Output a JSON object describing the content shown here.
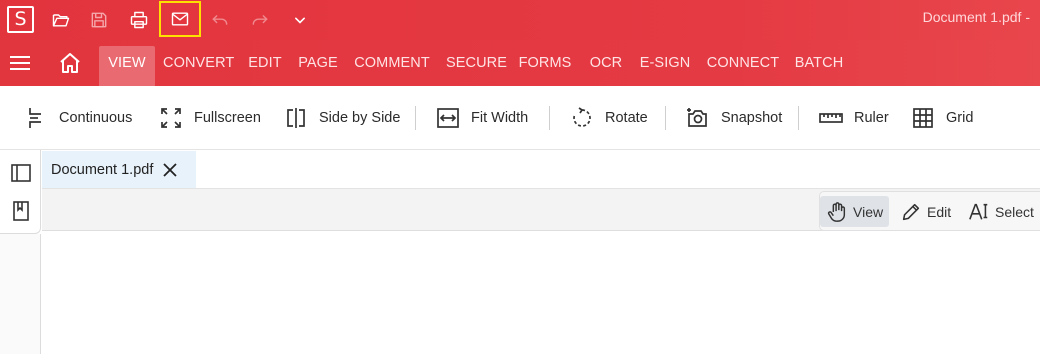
{
  "titlebar": {
    "logo_letter": "S",
    "document_title": "Document 1.pdf  -",
    "quick_access": [
      {
        "icon": "open-folder-icon",
        "highlighted": false
      },
      {
        "icon": "save-icon",
        "highlighted": false
      },
      {
        "icon": "print-icon",
        "highlighted": false
      },
      {
        "icon": "email-icon",
        "highlighted": true
      },
      {
        "icon": "undo-icon",
        "highlighted": false
      },
      {
        "icon": "redo-icon",
        "highlighted": false
      },
      {
        "icon": "chevron-down-icon",
        "highlighted": false
      }
    ]
  },
  "menubar": {
    "items": [
      "VIEW",
      "CONVERT",
      "EDIT",
      "PAGE",
      "COMMENT",
      "SECURE",
      "FORMS",
      "OCR",
      "E-SIGN",
      "CONNECT",
      "BATCH"
    ],
    "active": "VIEW"
  },
  "toolbar": {
    "continuous": "Continuous",
    "fullscreen": "Fullscreen",
    "side_by_side": "Side by Side",
    "fit_width": "Fit Width",
    "rotate": "Rotate",
    "snapshot": "Snapshot",
    "ruler": "Ruler",
    "grid": "Grid"
  },
  "document_tabs": [
    {
      "label": "Document 1.pdf",
      "active": true
    }
  ],
  "modes": {
    "view": "View",
    "edit": "Edit",
    "select": "Select"
  },
  "colors": {
    "brand_red": "#e2363e",
    "active_menu": "#e96a70",
    "highlight": "#ffe100",
    "tab_background": "#e8f2fb"
  }
}
